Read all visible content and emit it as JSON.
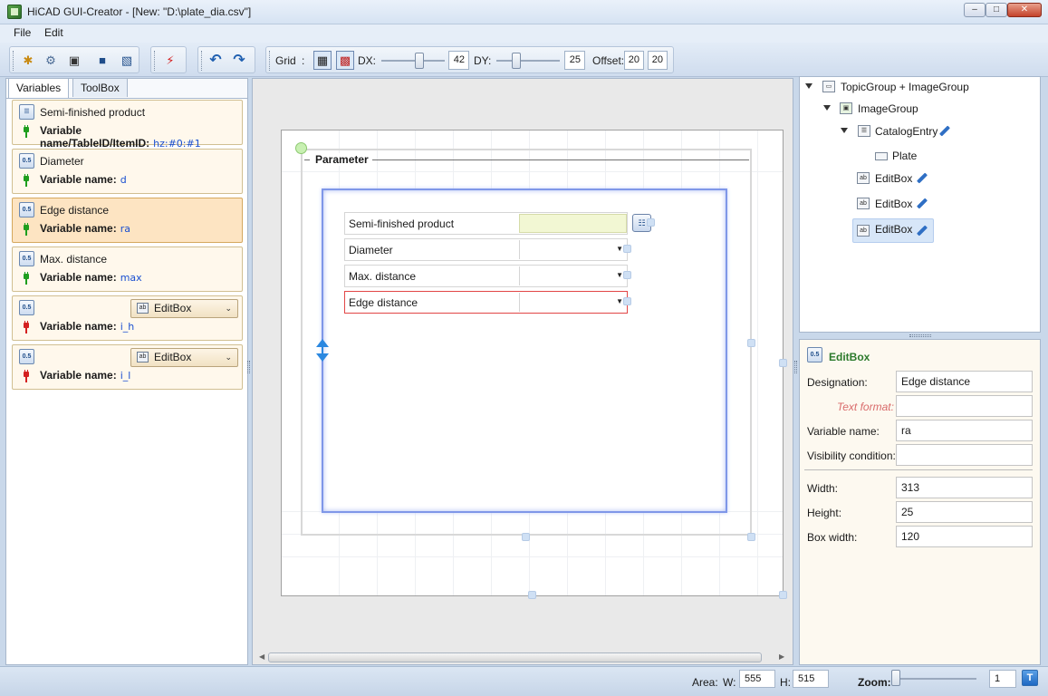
{
  "window": {
    "title": "HiCAD GUI-Creator - [New: \"D:\\plate_dia.csv\"]",
    "controls": [
      "minimize",
      "maximize",
      "close"
    ]
  },
  "menu": [
    {
      "label": "File"
    },
    {
      "label": "Edit"
    }
  ],
  "toolbar": {
    "icons": [
      "new-icon",
      "new-from-template-icon",
      "open-icon",
      "save-icon",
      "save-as-icon",
      "connect-plug-icon",
      "undo-icon",
      "redo-icon"
    ],
    "grid_label": "Grid",
    "grid_sep": ":",
    "dx_label": "DX:",
    "dx_value": "42",
    "dy_label": "DY:",
    "dy_value": "25",
    "offset_label": "Offset:",
    "offset_x": "20",
    "offset_y": "20"
  },
  "left_panel": {
    "tabs": [
      {
        "label": "Variables",
        "active": true
      },
      {
        "label": "ToolBox",
        "active": false
      }
    ],
    "variables": [
      {
        "title": "Semi-finished product",
        "var_label": "Variable name/TableID/ItemID:",
        "var_value": "hz:#0:#1",
        "plug": "green",
        "selected": false,
        "icon": "catalog-icon"
      },
      {
        "title": "Diameter",
        "var_label": "Variable name:",
        "var_value": "d",
        "plug": "green",
        "selected": false,
        "icon": "number-0.5-icon"
      },
      {
        "title": "Edge distance",
        "var_label": "Variable name:",
        "var_value": "ra",
        "plug": "green",
        "selected": true,
        "icon": "number-0.5-icon"
      },
      {
        "title": "Max. distance",
        "var_label": "Variable name:",
        "var_value": "max",
        "plug": "green",
        "selected": false,
        "icon": "number-0.5-icon"
      },
      {
        "title": "",
        "var_label": "Variable name:",
        "var_value": "i_h",
        "plug": "red",
        "selected": false,
        "icon": "number-0.5-icon",
        "control": "EditBox"
      },
      {
        "title": "",
        "var_label": "Variable name:",
        "var_value": "i_l",
        "plug": "red",
        "selected": false,
        "icon": "number-0.5-icon",
        "control": "EditBox"
      }
    ]
  },
  "canvas": {
    "group_title": "Parameter",
    "fields": [
      {
        "label": "Semi-finished product",
        "type": "catalog",
        "active": false
      },
      {
        "label": "Diameter",
        "type": "combo",
        "active": false
      },
      {
        "label": "Max. distance",
        "type": "combo",
        "active": false
      },
      {
        "label": "Edge distance",
        "type": "combo",
        "active": true
      }
    ]
  },
  "tree": {
    "nodes": [
      {
        "label": "TopicGroup + ImageGroup",
        "icon": "topic-group-icon",
        "expanded": true
      },
      {
        "label": "ImageGroup",
        "icon": "image-group-icon",
        "expanded": true
      },
      {
        "label": "CatalogEntry",
        "icon": "catalog-entry-icon",
        "expanded": true,
        "editable": true
      },
      {
        "label": "Plate",
        "icon": "plate-icon"
      },
      {
        "label": "EditBox",
        "icon": "editbox-icon",
        "editable": true
      },
      {
        "label": "EditBox",
        "icon": "editbox-icon",
        "editable": true
      },
      {
        "label": "EditBox",
        "icon": "editbox-icon",
        "editable": true,
        "selected": true
      }
    ]
  },
  "properties": {
    "header": "EditBox",
    "designation_label": "Designation:",
    "designation_value": "Edge distance",
    "text_format_label": "Text format:",
    "text_format_value": "",
    "variable_name_label": "Variable name:",
    "variable_name_value": "ra",
    "visibility_label": "Visibility condition:",
    "visibility_value": "",
    "width_label": "Width:",
    "width_value": "313",
    "height_label": "Height:",
    "height_value": "25",
    "box_width_label": "Box width:",
    "box_width_value": "120"
  },
  "status": {
    "area_label": "Area:",
    "w_label": "W:",
    "w_value": "555",
    "h_label": "H:",
    "h_value": "515",
    "zoom_label": "Zoom:",
    "zoom_value": "1"
  },
  "colors": {
    "selected_card": "#fde4c2",
    "card": "#fff8ec",
    "active_field_border": "#e24646",
    "inner_box_border": "#7f97e8",
    "header_green": "#2c7a2c"
  }
}
